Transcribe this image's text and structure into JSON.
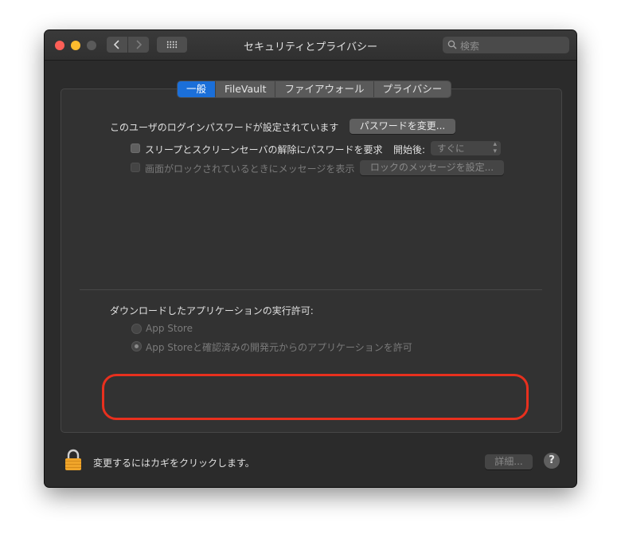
{
  "window": {
    "title": "セキュリティとプライバシー"
  },
  "toolbar": {
    "back_icon": "chevron-left-icon",
    "forward_icon": "chevron-right-icon",
    "grid_icon": "grid-icon",
    "search_placeholder": "検索"
  },
  "tabs": [
    {
      "label": "一般",
      "active": true
    },
    {
      "label": "FileVault",
      "active": false
    },
    {
      "label": "ファイアウォール",
      "active": false
    },
    {
      "label": "プライバシー",
      "active": false
    }
  ],
  "general": {
    "password_set_text": "このユーザのログインパスワードが設定されています",
    "change_password_button": "パスワードを変更...",
    "require_password_label": "スリープとスクリーンセーバの解除にパスワードを要求",
    "start_after_label": "開始後:",
    "start_after_value": "すぐに",
    "show_message_label": "画面がロックされているときにメッセージを表示",
    "set_lock_message_button": "ロックのメッセージを設定...",
    "downloads_heading": "ダウンロードしたアプリケーションの実行許可:",
    "radio_app_store": "App Store",
    "radio_app_store_identified": "App Storeと確認済みの開発元からのアプリケーションを許可"
  },
  "footer": {
    "lock_text": "変更するにはカギをクリックします。",
    "advanced_button": "詳細...",
    "help_label": "?"
  },
  "colors": {
    "accent": "#1b6fd9",
    "highlight_border": "#e8301e",
    "lock_gold": "#f0a52a"
  }
}
